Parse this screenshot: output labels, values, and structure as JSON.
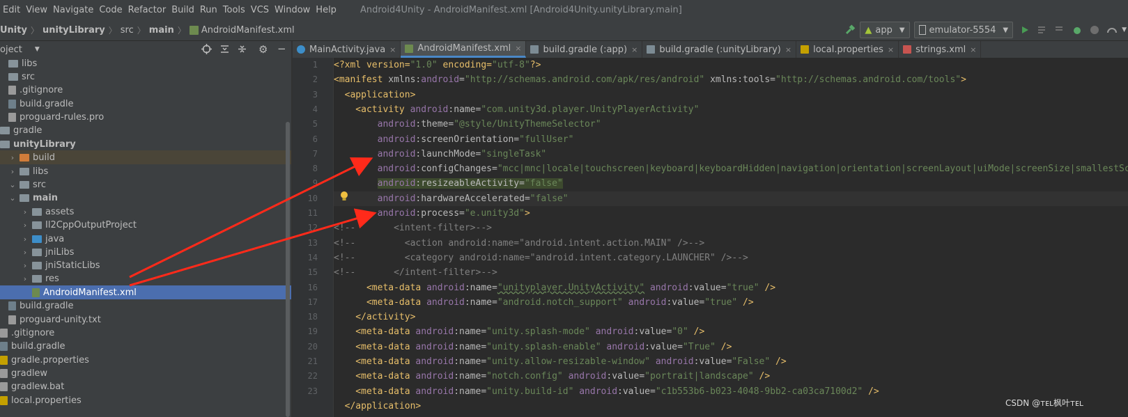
{
  "menu": [
    "Edit",
    "View",
    "Navigate",
    "Code",
    "Refactor",
    "Build",
    "Run",
    "Tools",
    "VCS",
    "Window",
    "Help"
  ],
  "window_title": "Android4Unity - AndroidManifest.xml [Android4Unity.unityLibrary.main]",
  "breadcrumb": [
    "Unity",
    "unityLibrary",
    "src",
    "main",
    "AndroidManifest.xml"
  ],
  "run_config": "app",
  "device": "emulator-5554",
  "project_label": "oject",
  "tree": [
    {
      "label": "libs",
      "kind": "folder",
      "indent": 1
    },
    {
      "label": "src",
      "kind": "folder",
      "indent": 1
    },
    {
      "label": ".gitignore",
      "kind": "file",
      "indent": 1
    },
    {
      "label": "build.gradle",
      "kind": "gradle",
      "indent": 1
    },
    {
      "label": "proguard-rules.pro",
      "kind": "file",
      "indent": 1
    },
    {
      "label": "gradle",
      "kind": "folder",
      "indent": 0
    },
    {
      "label": "unityLibrary",
      "kind": "module",
      "indent": 0
    },
    {
      "label": "build",
      "kind": "folder-excluded",
      "indent": 1
    },
    {
      "label": "libs",
      "kind": "folder",
      "indent": 1
    },
    {
      "label": "src",
      "kind": "folder",
      "indent": 1
    },
    {
      "label": "main",
      "kind": "folder-open",
      "indent": 2
    },
    {
      "label": "assets",
      "kind": "folder",
      "indent": 3
    },
    {
      "label": "Il2CppOutputProject",
      "kind": "folder",
      "indent": 3
    },
    {
      "label": "java",
      "kind": "folder-src",
      "indent": 3
    },
    {
      "label": "jniLibs",
      "kind": "folder",
      "indent": 3
    },
    {
      "label": "jniStaticLibs",
      "kind": "folder",
      "indent": 3
    },
    {
      "label": "res",
      "kind": "folder",
      "indent": 3
    },
    {
      "label": "AndroidManifest.xml",
      "kind": "xml",
      "indent": 3
    },
    {
      "label": "build.gradle",
      "kind": "gradle",
      "indent": 1
    },
    {
      "label": "proguard-unity.txt",
      "kind": "file",
      "indent": 1
    },
    {
      "label": ".gitignore",
      "kind": "file",
      "indent": 0
    },
    {
      "label": "build.gradle",
      "kind": "gradle",
      "indent": 0
    },
    {
      "label": "gradle.properties",
      "kind": "props",
      "indent": 0
    },
    {
      "label": "gradlew",
      "kind": "file",
      "indent": 0
    },
    {
      "label": "gradlew.bat",
      "kind": "file",
      "indent": 0
    },
    {
      "label": "local.properties",
      "kind": "props",
      "indent": 0
    }
  ],
  "tabs": [
    {
      "label": "MainActivity.java",
      "icon": "java-class-icon"
    },
    {
      "label": "AndroidManifest.xml",
      "icon": "xml-file-icon",
      "active": true
    },
    {
      "label": "build.gradle (:app)",
      "icon": "gradle-icon"
    },
    {
      "label": "build.gradle (:unityLibrary)",
      "icon": "gradle-icon"
    },
    {
      "label": "local.properties",
      "icon": "properties-icon"
    },
    {
      "label": "strings.xml",
      "icon": "xml-file-icon"
    }
  ],
  "line_numbers": [
    "1",
    "2",
    "3",
    "4",
    "5",
    "6",
    "7",
    "8",
    "9",
    "10",
    "11",
    "12",
    "13",
    "14",
    "15",
    "16",
    "17",
    "18",
    "19",
    "20",
    "21",
    "22",
    "23"
  ],
  "code": [
    [
      [
        "p",
        "<?xml version="
      ],
      [
        "v",
        "\"1.0\""
      ],
      [
        "p",
        " encoding="
      ],
      [
        "v",
        "\"utf-8\""
      ],
      [
        "p",
        "?>"
      ]
    ],
    [
      [
        "t",
        "<manifest "
      ],
      [
        "a",
        "xmlns:"
      ],
      [
        "ns",
        "android"
      ],
      [
        "a",
        "="
      ],
      [
        "v",
        "\"http://schemas.android.com/apk/res/android\""
      ],
      [
        "a",
        " xmlns:tools="
      ],
      [
        "v",
        "\"http://schemas.android.com/tools\""
      ],
      [
        "t",
        ">"
      ]
    ],
    [
      [
        "t",
        "  <application>"
      ]
    ],
    [
      [
        "t",
        "    <activity "
      ],
      [
        "ns",
        "android"
      ],
      [
        "a",
        ":name="
      ],
      [
        "v",
        "\"com.unity3d.player.UnityPlayerActivity\""
      ]
    ],
    [
      [
        "ns",
        "        android"
      ],
      [
        "a",
        ":theme="
      ],
      [
        "v",
        "\"@style/UnityThemeSelector\""
      ]
    ],
    [
      [
        "ns",
        "        android"
      ],
      [
        "a",
        ":screenOrientation="
      ],
      [
        "v",
        "\"fullUser\""
      ]
    ],
    [
      [
        "ns",
        "        android"
      ],
      [
        "a",
        ":launchMode="
      ],
      [
        "v",
        "\"singleTask\""
      ]
    ],
    [
      [
        "ns",
        "        android"
      ],
      [
        "a",
        ":configChanges="
      ],
      [
        "v",
        "\"mcc|mnc|locale|touchscreen|keyboard|keyboardHidden|navigation|orientation|screenLayout|uiMode|screenSize|smallestScreenSize\""
      ]
    ],
    [
      [
        "ns",
        "        "
      ],
      [
        "rs",
        "android:resizeableActivity=\"false\""
      ]
    ],
    [
      [
        "ns",
        "        android"
      ],
      [
        "a",
        ":hardwareAccelerated="
      ],
      [
        "v",
        "\"false\""
      ]
    ],
    [
      [
        "ns",
        "        android"
      ],
      [
        "a",
        ":process="
      ],
      [
        "v",
        "\"e.unity3d\""
      ],
      [
        "t",
        ">"
      ]
    ],
    [
      [
        "c",
        "<!--       <intent-filter>-->"
      ]
    ],
    [
      [
        "c",
        "<!--         <action android:name=\"android.intent.action.MAIN\" />-->"
      ]
    ],
    [
      [
        "c",
        "<!--         <category android:name=\"android.intent.category.LAUNCHER\" />-->"
      ]
    ],
    [
      [
        "c",
        "<!--       </intent-filter>-->"
      ]
    ],
    [
      [
        "t",
        "      <meta-data "
      ],
      [
        "ns",
        "android"
      ],
      [
        "a",
        ":name="
      ],
      [
        "wv",
        "\"unityplayer.UnityActivity\""
      ],
      [
        "a",
        " "
      ],
      [
        "ns",
        "android"
      ],
      [
        "a",
        ":value="
      ],
      [
        "v",
        "\"true\""
      ],
      [
        "t",
        " />"
      ]
    ],
    [
      [
        "t",
        "      <meta-data "
      ],
      [
        "ns",
        "android"
      ],
      [
        "a",
        ":name="
      ],
      [
        "v",
        "\"android.notch_support\""
      ],
      [
        "a",
        " "
      ],
      [
        "ns",
        "android"
      ],
      [
        "a",
        ":value="
      ],
      [
        "v",
        "\"true\""
      ],
      [
        "t",
        " />"
      ]
    ],
    [
      [
        "t",
        "    </activity>"
      ]
    ],
    [
      [
        "t",
        "    <meta-data "
      ],
      [
        "ns",
        "android"
      ],
      [
        "a",
        ":name="
      ],
      [
        "v",
        "\"unity.splash-mode\""
      ],
      [
        "a",
        " "
      ],
      [
        "ns",
        "android"
      ],
      [
        "a",
        ":value="
      ],
      [
        "v",
        "\"0\""
      ],
      [
        "t",
        " />"
      ]
    ],
    [
      [
        "t",
        "    <meta-data "
      ],
      [
        "ns",
        "android"
      ],
      [
        "a",
        ":name="
      ],
      [
        "v",
        "\"unity.splash-enable\""
      ],
      [
        "a",
        " "
      ],
      [
        "ns",
        "android"
      ],
      [
        "a",
        ":value="
      ],
      [
        "v",
        "\"True\""
      ],
      [
        "t",
        " />"
      ]
    ],
    [
      [
        "t",
        "    <meta-data "
      ],
      [
        "ns",
        "android"
      ],
      [
        "a",
        ":name="
      ],
      [
        "v",
        "\"unity.allow-resizable-window\""
      ],
      [
        "a",
        " "
      ],
      [
        "ns",
        "android"
      ],
      [
        "a",
        ":value="
      ],
      [
        "v",
        "\"False\""
      ],
      [
        "t",
        " />"
      ]
    ],
    [
      [
        "t",
        "    <meta-data "
      ],
      [
        "ns",
        "android"
      ],
      [
        "a",
        ":name="
      ],
      [
        "v",
        "\"notch.config\""
      ],
      [
        "a",
        " "
      ],
      [
        "ns",
        "android"
      ],
      [
        "a",
        ":value="
      ],
      [
        "v",
        "\"portrait|landscape\""
      ],
      [
        "t",
        " />"
      ]
    ],
    [
      [
        "t",
        "    <meta-data "
      ],
      [
        "ns",
        "android"
      ],
      [
        "a",
        ":name="
      ],
      [
        "v",
        "\"unity.build-id\""
      ],
      [
        "a",
        " "
      ],
      [
        "ns",
        "android"
      ],
      [
        "a",
        ":value="
      ],
      [
        "v",
        "\"c1b553b6-b023-4048-9bb2-ca03ca7100d2\""
      ],
      [
        "t",
        " />"
      ]
    ],
    [
      [
        "t",
        "  </application>"
      ]
    ]
  ],
  "watermark": "CSDN @ᴛᴇʟ枫叶ᴛᴇʟ",
  "colors": {
    "accent": "#4b6eaf",
    "arrow": "#ff2a1a",
    "tag": "#e8bf6a",
    "string": "#6a8759"
  }
}
